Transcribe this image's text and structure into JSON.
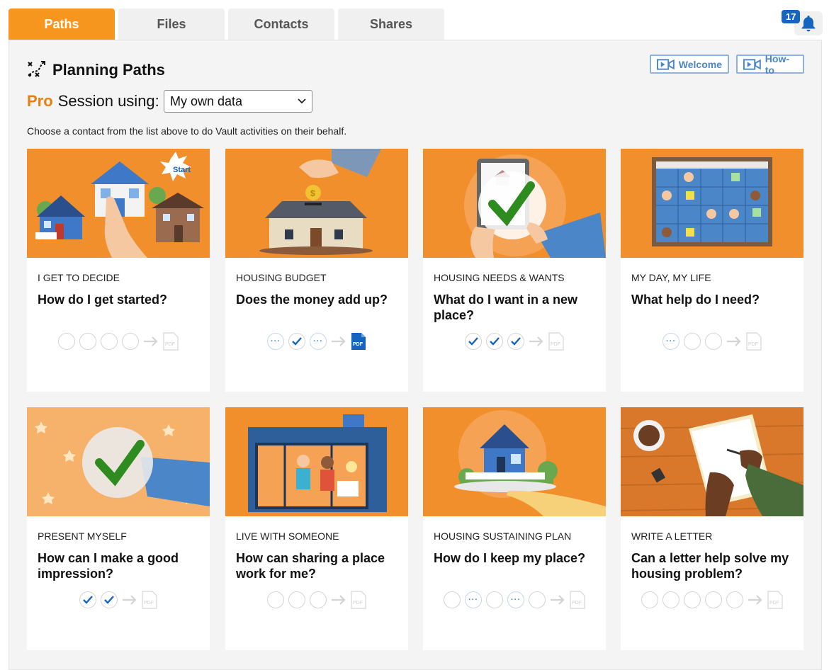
{
  "tabs": [
    {
      "label": "Paths",
      "active": true
    },
    {
      "label": "Files",
      "active": false
    },
    {
      "label": "Contacts",
      "active": false
    },
    {
      "label": "Shares",
      "active": false
    }
  ],
  "notifications": {
    "count": "17",
    "icon": "bell-icon"
  },
  "header": {
    "title": "Planning Paths",
    "welcome_label": "Welcome",
    "howto_label": "How-to"
  },
  "session": {
    "pro_label": "Pro",
    "label": "Session using:",
    "selected": "My own data"
  },
  "hint": "Choose a contact from the list above to do Vault activities on their behalf.",
  "colors": {
    "accent": "#f7961f",
    "brand_blue": "#1565c0",
    "tab_bg": "#f0f0f0"
  },
  "cards": [
    {
      "category": "I GET TO DECIDE",
      "question": "How do I get started?",
      "steps": [
        "empty",
        "empty",
        "empty",
        "empty"
      ],
      "pdf_active": false
    },
    {
      "category": "HOUSING BUDGET",
      "question": "Does the money add up?",
      "steps": [
        "dots",
        "check",
        "dots"
      ],
      "pdf_active": true
    },
    {
      "category": "HOUSING NEEDS & WANTS",
      "question": "What do I want in a new place?",
      "steps": [
        "check",
        "check",
        "check"
      ],
      "pdf_active": false
    },
    {
      "category": "MY DAY, MY LIFE",
      "question": "What help do I need?",
      "steps": [
        "dots",
        "empty",
        "empty"
      ],
      "pdf_active": false
    },
    {
      "category": "PRESENT MYSELF",
      "question": "How can I make a good impression?",
      "steps": [
        "check",
        "check"
      ],
      "pdf_active": false
    },
    {
      "category": "LIVE WITH SOMEONE",
      "question": "How can sharing a place work for me?",
      "steps": [
        "empty",
        "empty",
        "empty"
      ],
      "pdf_active": false
    },
    {
      "category": "HOUSING SUSTAINING PLAN",
      "question": "How do I keep my place?",
      "steps": [
        "empty",
        "dots",
        "empty",
        "dots",
        "empty"
      ],
      "pdf_active": false
    },
    {
      "category": "WRITE A LETTER",
      "question": "Can a letter help solve my housing problem?",
      "steps": [
        "empty",
        "empty",
        "empty",
        "empty",
        "empty"
      ],
      "pdf_active": false
    }
  ]
}
